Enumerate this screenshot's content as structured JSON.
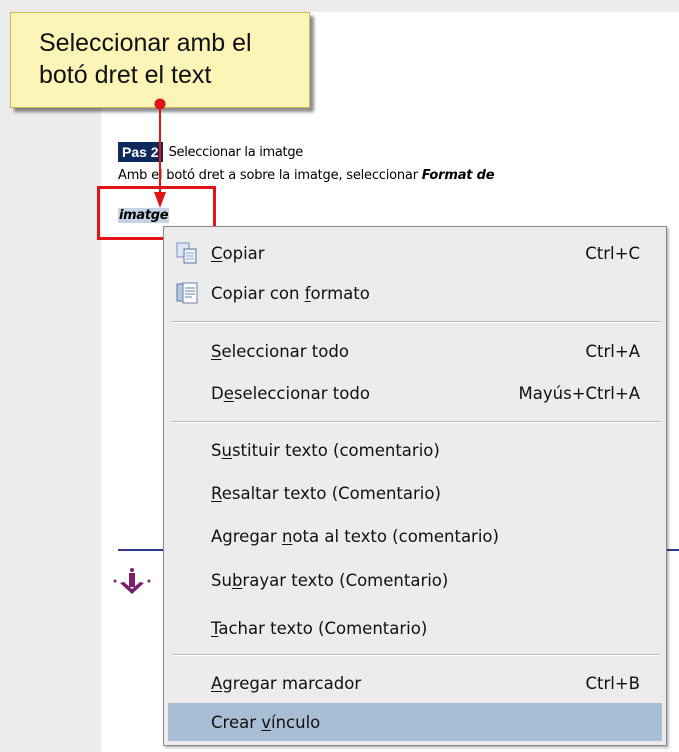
{
  "document": {
    "step_badge": "Pas 2",
    "step_title": "Seleccionar la imatge",
    "instruction_prefix": "Amb el botó dret a sobre la imatge, seleccionar ",
    "instruction_bold": "Format de",
    "instruction_line2": "imatge"
  },
  "callout": {
    "text": "Seleccionar amb el botó dret el text"
  },
  "context_menu": {
    "items": [
      {
        "pre": "",
        "ul": "C",
        "post": "opiar",
        "shortcut": "Ctrl+C",
        "icon": "copy-icon"
      },
      {
        "pre": "Copiar con ",
        "ul": "f",
        "post": "ormato",
        "shortcut": "",
        "icon": "copy-format-icon"
      },
      {
        "pre": "",
        "ul": "S",
        "post": "eleccionar todo",
        "shortcut": "Ctrl+A"
      },
      {
        "pre": "D",
        "ul": "e",
        "post": "seleccionar todo",
        "shortcut": "Mayús+Ctrl+A"
      },
      {
        "pre": "S",
        "ul": "u",
        "post": "stituir texto (comentario)",
        "shortcut": ""
      },
      {
        "pre": "",
        "ul": "R",
        "post": "esaltar texto (Comentario)",
        "shortcut": ""
      },
      {
        "pre": "Agregar ",
        "ul": "n",
        "post": "ota al texto (comentario)",
        "shortcut": ""
      },
      {
        "pre": "Su",
        "ul": "b",
        "post": "rayar texto (Comentario)",
        "shortcut": ""
      },
      {
        "pre": "",
        "ul": "T",
        "post": "achar texto (Comentario)",
        "shortcut": ""
      },
      {
        "pre": "",
        "ul": "A",
        "post": "gregar marcador",
        "shortcut": "Ctrl+B"
      },
      {
        "pre": "Crear ",
        "ul": "v",
        "post": "ínculo",
        "shortcut": ""
      }
    ]
  },
  "colors": {
    "highlight": "#a9bed5",
    "callout_bg": "#fdf4b8",
    "red": "#e2141a",
    "badge": "#0e2a5c"
  }
}
